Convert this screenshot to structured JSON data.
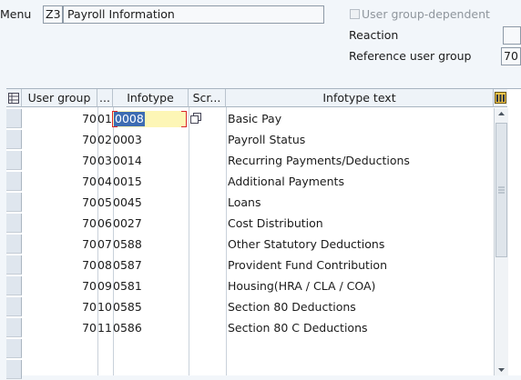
{
  "header": {
    "menu_label": "Menu",
    "menu_code": "Z3",
    "menu_text": "Payroll Information",
    "user_group_dependent_label": "User group-dependent",
    "reaction_label": "Reaction",
    "reference_user_group_label": "Reference user group",
    "reference_user_group_value": "70"
  },
  "table": {
    "columns": [
      "User group",
      "...",
      "Infotype",
      "Scr...",
      "Infotype text"
    ],
    "rows": [
      {
        "user_group": "70",
        "num": "01",
        "infotype": "0008",
        "scr": "",
        "text": "Basic Pay"
      },
      {
        "user_group": "70",
        "num": "02",
        "infotype": "0003",
        "scr": "",
        "text": "Payroll Status"
      },
      {
        "user_group": "70",
        "num": "03",
        "infotype": "0014",
        "scr": "",
        "text": "Recurring Payments/Deductions"
      },
      {
        "user_group": "70",
        "num": "04",
        "infotype": "0015",
        "scr": "",
        "text": "Additional Payments"
      },
      {
        "user_group": "70",
        "num": "05",
        "infotype": "0045",
        "scr": "",
        "text": "Loans"
      },
      {
        "user_group": "70",
        "num": "06",
        "infotype": "0027",
        "scr": "",
        "text": "Cost Distribution"
      },
      {
        "user_group": "70",
        "num": "07",
        "infotype": "0588",
        "scr": "",
        "text": "Other Statutory Deductions"
      },
      {
        "user_group": "70",
        "num": "08",
        "infotype": "0587",
        "scr": "",
        "text": "Provident Fund Contribution"
      },
      {
        "user_group": "70",
        "num": "09",
        "infotype": "0581",
        "scr": "",
        "text": "Housing(HRA / CLA / COA)"
      },
      {
        "user_group": "70",
        "num": "10",
        "infotype": "0585",
        "scr": "",
        "text": "Section 80 Deductions"
      },
      {
        "user_group": "70",
        "num": "11",
        "infotype": "0586",
        "scr": "",
        "text": "Section 80 C Deductions"
      }
    ]
  },
  "icons": {
    "table_settings": "table-settings-icon",
    "column_config": "column-config-icon",
    "value_help": "value-help-icon",
    "scroll_up": "scroll-up-icon",
    "scroll_down": "scroll-down-icon"
  }
}
